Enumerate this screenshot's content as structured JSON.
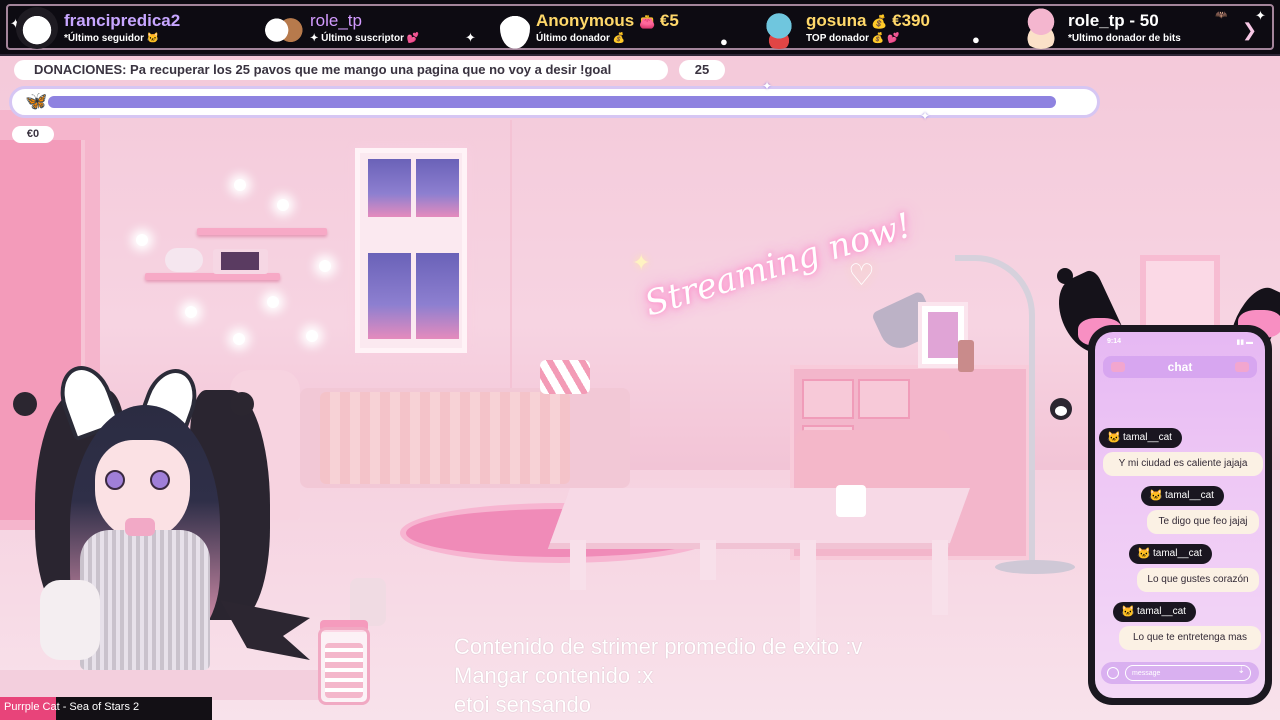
{
  "topbar": {
    "latest_follower": {
      "name": "francipredica2",
      "label": "*Último seguidor",
      "name_color": "#c7a6ff"
    },
    "latest_subscriber": {
      "name": "role_tp",
      "label": "Último suscriptor",
      "name_color": "#d39bff"
    },
    "latest_donor": {
      "name": "Anonymous",
      "amount": "€5",
      "label": "Último donador",
      "name_color": "#ffd86a"
    },
    "top_donor": {
      "name": "gosuna",
      "amount": "€390",
      "label": "TOP donador",
      "name_color": "#ffd86a"
    },
    "latest_bits_donor": {
      "name": "role_tp - 50",
      "label": "*Ultimo donador de bits",
      "name_color": "#ffffff"
    }
  },
  "donations": {
    "message": "DONACIONES: Pa recuperar los 25 pavos que me mango una pagina que no voy a desir !goal",
    "goal_count": "25",
    "current_amount": "€0",
    "progress_fraction": 0.97,
    "fill_color": "#8e82e0"
  },
  "scene": {
    "neon_sign": "Streaming now!"
  },
  "chat": {
    "header": "chat",
    "status_time": "9:14",
    "input_placeholder": "message",
    "messages": [
      {
        "user": "tamal__cat",
        "text": "Y mi ciudad es caliente jajaja"
      },
      {
        "user": "tamal__cat",
        "text": "Te digo que feo jajaj"
      },
      {
        "user": "tamal__cat",
        "text": "Lo que gustes corazón"
      },
      {
        "user": "tamal__cat",
        "text": "Lo que te entretenga mas"
      }
    ]
  },
  "caption": {
    "line1": "Contenido de strimer promedio de exito :v",
    "line2": "Mangar contenido :x",
    "line3": "etoi sensando"
  },
  "now_playing": {
    "text": "Purrple Cat - Sea of Stars 2"
  },
  "colors": {
    "accent_pink": "#f39bba",
    "topbar_bg": "#0d0b12",
    "chat_bg": "#e6b8f3"
  }
}
